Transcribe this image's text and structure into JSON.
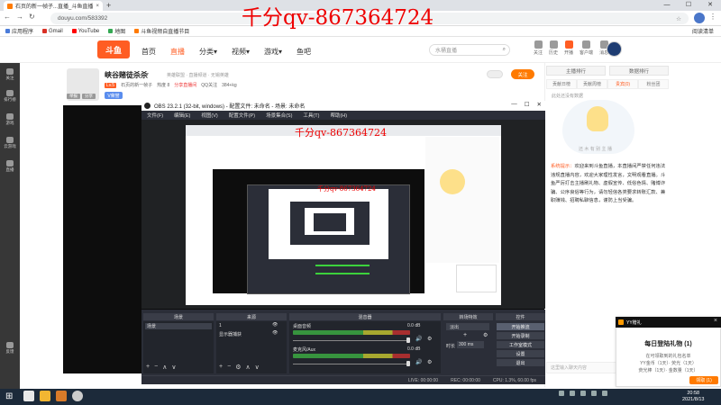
{
  "browser": {
    "tab_title": "石页的新一帧子...直播_斗鱼直播",
    "tab_close": "×",
    "new_tab": "+",
    "url": "douyu.com/583392",
    "window_controls": [
      "—",
      "☐",
      "✕"
    ],
    "nav": [
      "←",
      "→",
      "↻"
    ],
    "bookmarks": [
      "应用程序",
      "Gmail",
      "YouTube",
      "地图",
      "斗鱼视频自直播节目"
    ],
    "reading_list": "阅读清单"
  },
  "site": {
    "logo_text": "斗鱼",
    "nav": [
      "首页",
      "直播",
      "分类▾",
      "视频▾",
      "游戏▾",
      "鱼吧"
    ],
    "search_placeholder": "水桶直播",
    "header_icons": [
      "关注",
      "历史",
      "开播",
      "客户端",
      "消息"
    ]
  },
  "left_sidebar": [
    "关注",
    "排行榜",
    "游戏",
    "云游戏",
    "直播",
    "反馈"
  ],
  "streamer": {
    "title": "峡谷赌徒杀杀",
    "dropdown": "▾",
    "tags": "英雄联盟 · 直播频道 · 无锡英雄",
    "level_badge": "Lv.5",
    "room_info": "石页的新一帧子",
    "hot": "热度 8",
    "record": "分享直播间",
    "qq": "QQ关注",
    "size": "384+kg",
    "vip_badge": "V荣誉",
    "small_btns": [
      "举报",
      "分享"
    ],
    "follow_label": "关注"
  },
  "obs": {
    "title": "OBS 23.2.1 (32-bit, windows) - 配置文件: 未命名 - 场景: 未命名",
    "win_controls": [
      "—",
      "☐",
      "✕"
    ],
    "menu": [
      "文件(F)",
      "编辑(E)",
      "视图(V)",
      "配置文件(P)",
      "场景集合(S)",
      "工具(T)",
      "帮助(H)"
    ],
    "docks": {
      "scenes": "场景",
      "sources": "来源",
      "mixer": "混音器",
      "transitions": "转场特效",
      "controls": "控件"
    },
    "scene_items": [
      "场景"
    ],
    "source_items": [
      "1",
      "显示器捕获"
    ],
    "mixer_channels": [
      {
        "name": "桌面音频",
        "db": "0.0 dB"
      },
      {
        "name": "麦克风/Aux",
        "db": "0.0 dB"
      }
    ],
    "transition": "淡出",
    "duration_label": "时长",
    "duration": "300 ms",
    "controls": [
      "开始推流",
      "开始录制",
      "工作室模式",
      "设置",
      "退出"
    ],
    "status": [
      "LIVE: 00:00:00",
      "REC: 00:00:00",
      "CPU: 1.3%, 60.00 fps"
    ],
    "dock_buttons": [
      "+",
      "−",
      "∧",
      "∨"
    ]
  },
  "watermark": "千分qv-867364724",
  "right_panel": {
    "rank_tabs": [
      "主播排行",
      "数据排行"
    ],
    "rank_subtabs": [
      "贡献日榜",
      "贡献周榜",
      "贵宾(0)",
      "粉丝团"
    ],
    "empty_text": "此处还没有数据",
    "mascot_text": "还 木 有 别 主 播",
    "notice_label": "系统提示：",
    "notice_text": "欢迎来到斗鱼直播，本直播间严禁任何违法违规直播内容，欢迎大家理性发言，文明观看直播。斗鱼严厉打击主播刷礼物、虚假宣传、低俗色情、赌博诈骗、公序良俗等行为，请勿轻信各类要求转账汇款、兼职赚钱、招聘私聊信息，谨防上当受骗。",
    "chat_placeholder": "这里输入聊天内容"
  },
  "gift_popup": {
    "header": "YY赠礼",
    "close": "×",
    "title": "每日登陆礼物 (1)",
    "lines": [
      "在可领取到的礼包名单",
      "YY金币（1天）· 荧光（1天）",
      "荧光棒（1天）· 金数量（1天）"
    ],
    "button": "领取 (1)"
  },
  "taskbar": {
    "start": "⊞",
    "clock_time": "20:58",
    "clock_date": "2021/8/13"
  }
}
